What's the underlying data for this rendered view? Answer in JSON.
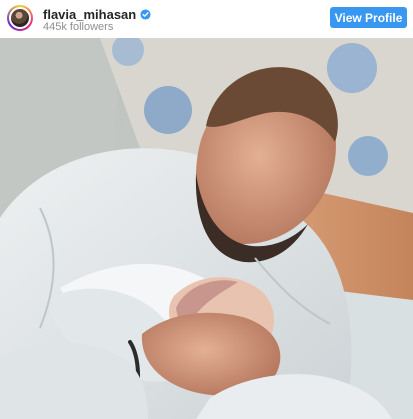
{
  "profile": {
    "username": "flavia_mihasan",
    "followers": "445k followers",
    "verified_icon": "verified-badge",
    "avatar_icon": "profile-avatar"
  },
  "actions": {
    "view_profile_label": "View Profile"
  },
  "colors": {
    "button": "#3897f0",
    "username": "#262626",
    "followers": "#8e8e8e",
    "verified": "#3897f0"
  },
  "post": {
    "image_subject": "man holding a newborn baby"
  }
}
